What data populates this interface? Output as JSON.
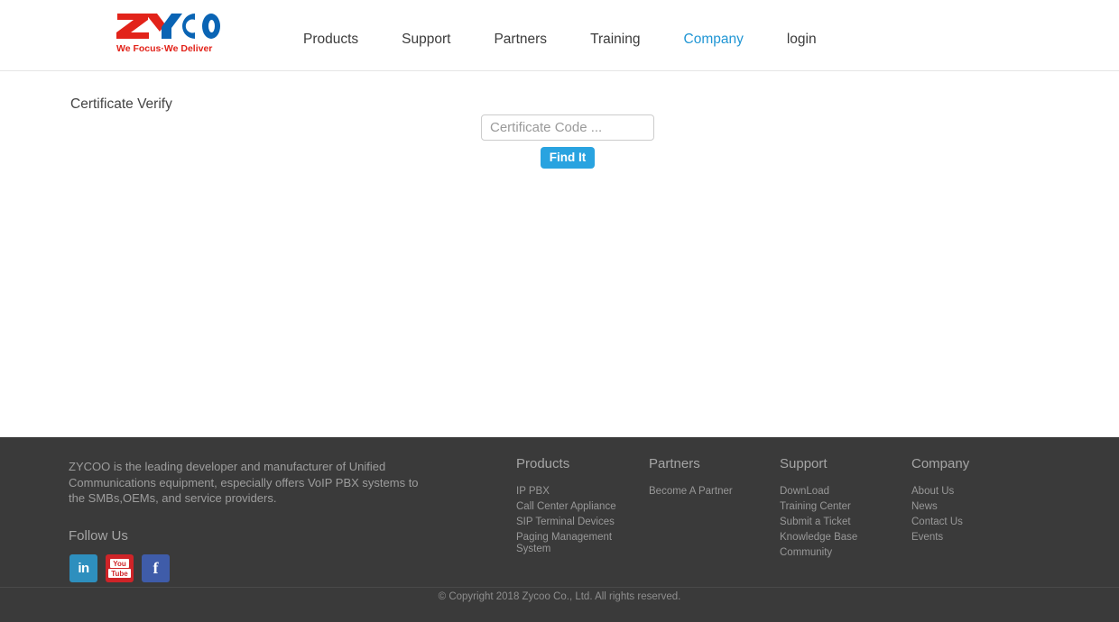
{
  "header": {
    "logo": {
      "name": "ZYCOO",
      "part_red": "ZY",
      "part_blue": "COO",
      "tagline": "We Focus·We Deliver",
      "color_red": "#e2231a",
      "color_blue": "#0a64b4"
    },
    "nav": [
      {
        "label": "Products",
        "active": false
      },
      {
        "label": "Support",
        "active": false
      },
      {
        "label": "Partners",
        "active": false
      },
      {
        "label": "Training",
        "active": false
      },
      {
        "label": "Company",
        "active": true
      },
      {
        "label": "login",
        "active": false
      }
    ],
    "active_color": "#2196d4"
  },
  "main": {
    "page_title": "Certificate Verify",
    "certificate_input": {
      "placeholder": "Certificate Code ...",
      "value": ""
    },
    "find_button": {
      "label": "Find It",
      "color": "#29a3e0"
    }
  },
  "footer": {
    "about_text": "ZYCOO is the leading developer and manufacturer of Unified Communications equipment, especially offers VoIP PBX systems to the SMBs,OEMs, and service providers.",
    "follow_title": "Follow Us",
    "social": [
      {
        "name": "linkedin",
        "glyph": "in",
        "color": "#2e8fbe"
      },
      {
        "name": "youtube",
        "glyph_top": "You",
        "glyph_bottom": "Tube",
        "color": "#cf2428"
      },
      {
        "name": "facebook",
        "glyph": "f",
        "color": "#3f5ca9"
      }
    ],
    "columns": [
      {
        "title": "Products",
        "links": [
          "IP PBX",
          "Call Center Appliance",
          "SIP Terminal Devices",
          "Paging Management System"
        ]
      },
      {
        "title": "Partners",
        "links": [
          "Become A Partner"
        ]
      },
      {
        "title": "Support",
        "links": [
          "DownLoad",
          "Training Center",
          "Submit a Ticket",
          "Knowledge Base",
          "Community"
        ]
      },
      {
        "title": "Company",
        "links": [
          "About Us",
          "News",
          "Contact Us",
          "Events"
        ]
      }
    ],
    "copyright": "© Copyright 2018 Zycoo Co., Ltd. All rights reserved.",
    "background": "#3a3a3a"
  }
}
